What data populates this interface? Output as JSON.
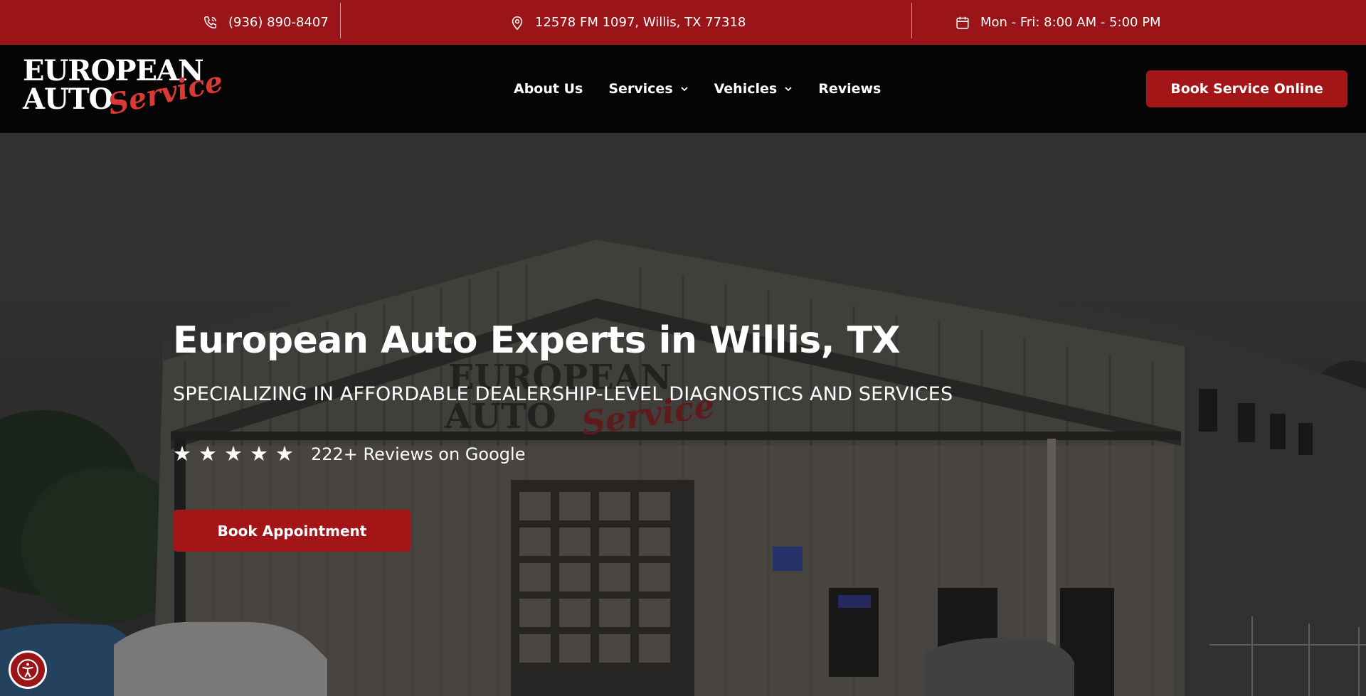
{
  "topbar": {
    "phone": "(936) 890-8407",
    "address": "12578 FM 1097, Willis, TX 77318",
    "hours": "Mon - Fri: 8:00 AM - 5:00 PM",
    "icons": [
      "phone-icon",
      "map-pin-icon",
      "calendar-icon"
    ],
    "background": "#9b1417"
  },
  "logo": {
    "line1": "EUROPEAN",
    "line2": "AUTO",
    "script": "Service"
  },
  "nav": {
    "items": [
      {
        "label": "About Us",
        "dropdown": false
      },
      {
        "label": "Services",
        "dropdown": true
      },
      {
        "label": "Vehicles",
        "dropdown": true
      },
      {
        "label": "Reviews",
        "dropdown": false
      }
    ],
    "cta": "Book Service Online"
  },
  "hero": {
    "title": "European Auto Experts in Willis, TX",
    "subtitle": "SPECIALIZING IN AFFORDABLE DEALERSHIP-LEVEL DIAGNOSTICS AND SERVICES",
    "stars": [
      "★",
      "★",
      "★",
      "★",
      "★"
    ],
    "rating": 5,
    "reviews_text": "222+ Reviews on Google",
    "cta": "Book Appointment",
    "sign": {
      "line1": "EUROPEAN",
      "line2": "AUTO",
      "script": "Service"
    }
  },
  "colors": {
    "accent": "#a41518",
    "header_bg": "#050505",
    "text": "#ffffff"
  },
  "accessibility_button": "accessibility-icon"
}
